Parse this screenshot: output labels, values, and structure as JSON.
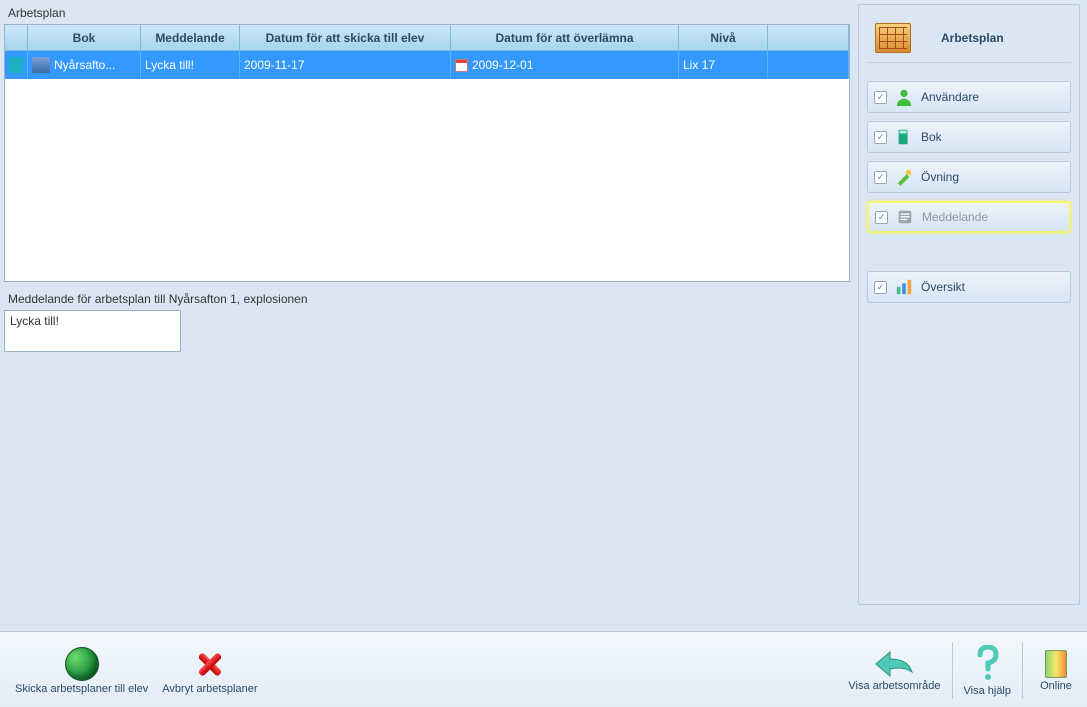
{
  "panel": {
    "title": "Arbetsplan",
    "msgLabel": "Meddelande för arbetsplan till Nyårsafton 1, explosionen",
    "msgValue": "Lycka till!"
  },
  "grid": {
    "headers": {
      "bok": "Bok",
      "meddelande": "Meddelande",
      "datum1": "Datum för att skicka till elev",
      "datum2": "Datum för att överlämna",
      "niva": "Nivå"
    },
    "row": {
      "bok": "Nyårsafto...",
      "meddelande": "Lycka till!",
      "datum1": "2009-11-17",
      "datum2": "2009-12-01",
      "niva": "Lix 17"
    }
  },
  "right": {
    "title": "Arbetsplan",
    "items": [
      {
        "label": "Användare",
        "checked": true
      },
      {
        "label": "Bok",
        "checked": true
      },
      {
        "label": "Övning",
        "checked": true
      },
      {
        "label": "Meddelande",
        "checked": true,
        "selected": true
      },
      {
        "label": "Översikt",
        "checked": true,
        "gapBefore": true
      }
    ]
  },
  "bottom": {
    "send": "Skicka arbetsplaner till elev",
    "cancel": "Avbryt arbetsplaner",
    "workspace": "Visa arbetsområde",
    "help": "Visa hjälp",
    "online": "Online"
  }
}
